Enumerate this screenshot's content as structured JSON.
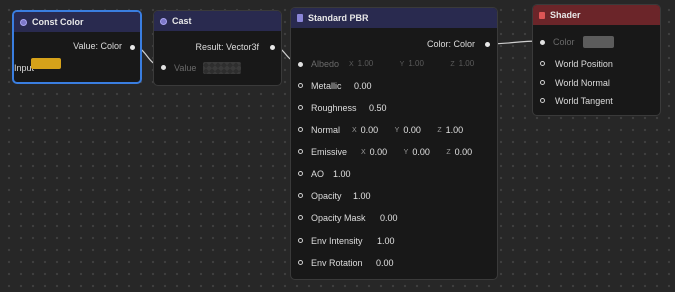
{
  "const_color": {
    "title": "Const Color",
    "output": "Value: Color",
    "input_label": "Input",
    "input_color": "#d6a21a"
  },
  "cast": {
    "title": "Cast",
    "output": "Result: Vector3f",
    "input_label": "Value"
  },
  "standard_pbr": {
    "title": "Standard PBR",
    "output": "Color: Color",
    "albedo": {
      "label": "Albedo",
      "x": "1.00",
      "y": "1.00",
      "z": "1.00"
    },
    "metallic": {
      "label": "Metallic",
      "value": "0.00"
    },
    "roughness": {
      "label": "Roughness",
      "value": "0.50"
    },
    "normal": {
      "label": "Normal",
      "x": "0.00",
      "y": "0.00",
      "z": "1.00"
    },
    "emissive": {
      "label": "Emissive",
      "x": "0.00",
      "y": "0.00",
      "z": "0.00"
    },
    "ao": {
      "label": "AO",
      "value": "1.00"
    },
    "opacity": {
      "label": "Opacity",
      "value": "1.00"
    },
    "opacity_mask": {
      "label": "Opacity Mask",
      "value": "0.00"
    },
    "env_intensity": {
      "label": "Env Intensity",
      "value": "1.00"
    },
    "env_rotation": {
      "label": "Env Rotation",
      "value": "0.00"
    },
    "axis_labels": {
      "x": "X",
      "y": "Y",
      "z": "Z"
    }
  },
  "shader": {
    "title": "Shader",
    "color_label": "Color",
    "color_swatch": "#5c5c5c",
    "inputs": [
      "World Position",
      "World Normal",
      "World Tangent"
    ]
  },
  "colors": {
    "background": "#272727",
    "node_body": "#181818",
    "header_default": "#292a4f",
    "header_shader": "#6b2529",
    "selection": "#3a7ee0"
  }
}
